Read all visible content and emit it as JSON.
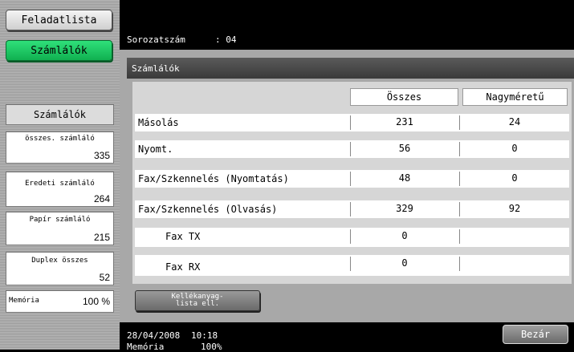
{
  "sidebar": {
    "tab_list": "Feladatlista",
    "tab_counter": "Számlálók",
    "title": "Számlálók",
    "boxes": [
      {
        "label": "összes. számláló",
        "value": "335"
      },
      {
        "label": "Eredeti számláló",
        "value": "264"
      },
      {
        "label": "Papír számláló",
        "value": "215"
      },
      {
        "label": "Duplex összes",
        "value": "52"
      },
      {
        "label": "Memória",
        "value": "100 %"
      }
    ]
  },
  "header": {
    "serial_label": "Sorozatszám",
    "serial_value": ": 04",
    "panel_title": "Számlálók"
  },
  "table": {
    "columns": [
      "Összes",
      "Nagyméretű"
    ],
    "rows": [
      {
        "name": "Másolás",
        "total": "231",
        "large": "24"
      },
      {
        "name": "Nyomt.",
        "total": "56",
        "large": "0"
      },
      {
        "name": "Fax/Szkennelés (Nyomtatás)",
        "total": "48",
        "large": "0"
      },
      {
        "name": "Fax/Szkennelés (Olvasás)",
        "total": "329",
        "large": "92"
      },
      {
        "name": "Fax TX",
        "total": "0",
        "large": ""
      },
      {
        "name": "Fax RX",
        "total": "0",
        "large": ""
      }
    ]
  },
  "buttons": {
    "supply": "Kellékanyag-\nlista ell.",
    "close": "Bezár"
  },
  "status": {
    "date": "28/04/2008",
    "time": "10:18",
    "memory_label": "Memória",
    "memory_value": "100%"
  }
}
